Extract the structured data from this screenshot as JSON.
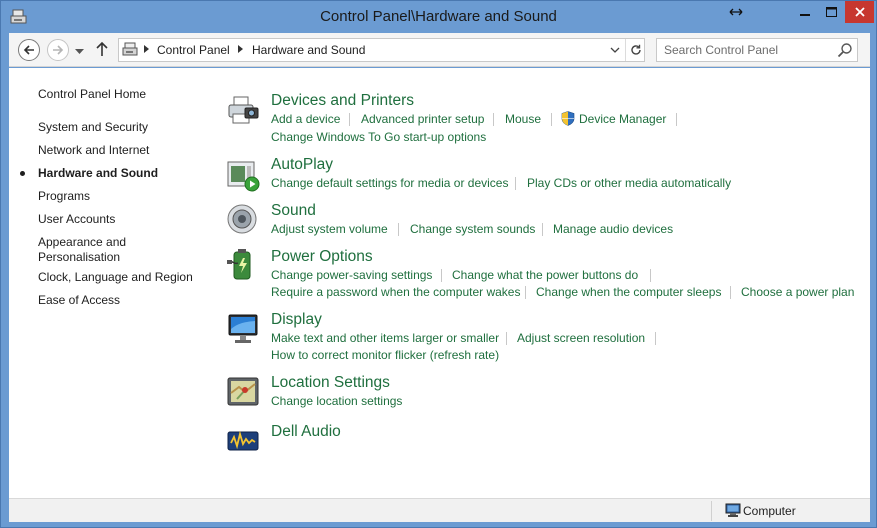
{
  "window": {
    "title": "Control Panel\\Hardware and Sound",
    "accent_color": "#6b9bd2",
    "close_color": "#c7372f"
  },
  "toolbar": {
    "back_icon": "back-arrow-icon",
    "forward_icon": "forward-arrow-icon",
    "recent_icon": "chevron-down-icon",
    "up_icon": "up-arrow-icon"
  },
  "address": {
    "breadcrumbs": [
      "Control Panel",
      "Hardware and Sound"
    ],
    "refresh_icon": "refresh-icon"
  },
  "search": {
    "placeholder": "Search Control Panel",
    "value": ""
  },
  "sidebar": {
    "items": [
      {
        "label": "Control Panel Home"
      },
      {
        "label": "System and Security"
      },
      {
        "label": "Network and Internet"
      },
      {
        "label": "Hardware and Sound",
        "active": true
      },
      {
        "label": "Programs"
      },
      {
        "label": "User Accounts"
      },
      {
        "label": "Appearance and Personalisation"
      },
      {
        "label": "Clock, Language and Region"
      },
      {
        "label": "Ease of Access"
      }
    ]
  },
  "link_color": "#1f6f3e",
  "categories": [
    {
      "title": "Devices and Printers",
      "icon": "printer-camera-icon",
      "links": [
        "Add a device",
        "Advanced printer setup",
        "Mouse",
        "Device Manager",
        "Change Windows To Go start-up options"
      ]
    },
    {
      "title": "AutoPlay",
      "icon": "autoplay-icon",
      "links": [
        "Change default settings for media or devices",
        "Play CDs or other media automatically"
      ]
    },
    {
      "title": "Sound",
      "icon": "speaker-icon",
      "links": [
        "Adjust system volume",
        "Change system sounds",
        "Manage audio devices"
      ]
    },
    {
      "title": "Power Options",
      "icon": "battery-icon",
      "links": [
        "Change power-saving settings",
        "Change what the power buttons do",
        "Require a password when the computer wakes",
        "Change when the computer sleeps",
        "Choose a power plan"
      ]
    },
    {
      "title": "Display",
      "icon": "monitor-icon",
      "links": [
        "Make text and other items larger or smaller",
        "Adjust screen resolution",
        "How to correct monitor flicker (refresh rate)"
      ]
    },
    {
      "title": "Location Settings",
      "icon": "location-map-icon",
      "links": [
        "Change location settings"
      ]
    },
    {
      "title": "Dell Audio",
      "icon": "dell-audio-icon",
      "links": []
    }
  ],
  "statusbar": {
    "label": "Computer",
    "icon": "computer-icon"
  }
}
